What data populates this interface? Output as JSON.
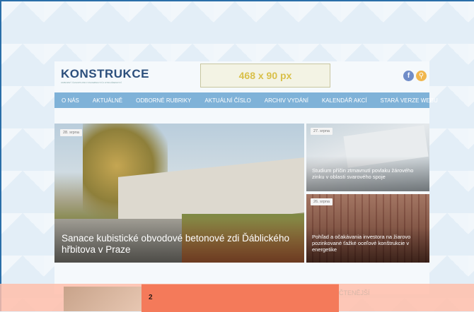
{
  "header": {
    "logo": "KONSTRUKCE",
    "logo_sub": "ODBORNÝ ČASOPIS PRO STAVEBNICTVÍ A STROJÍRENSTVÍ",
    "banner": "468 x 90 px",
    "facebook": "f",
    "search": "⚲"
  },
  "nav": [
    "O NÁS",
    "AKTUÁLNĚ",
    "ODBORNÉ RUBRIKY",
    "AKTUÁLNÍ ČÍSLO",
    "ARCHIV VYDÁNÍ",
    "KALENDÁŘ AKCÍ",
    "STARÁ VERZE WEBU"
  ],
  "hero": {
    "date": "28. srpna",
    "title": "Sanace kubistické obvodové betonové zdi Ďáblického hřbitova v Praze"
  },
  "cards": [
    {
      "date": "27. srpna",
      "title": "Studium příčin ztmavnutí povlaku žárového zinku v oblasti svarového spoje"
    },
    {
      "date": "26. srpna",
      "title": "Pohľad a očakávania investora na žiarovo pozinkované ťažké oceľové konštrukcie v energetike"
    }
  ],
  "overlay": {
    "mostread": "ČTENĚJŠÍ",
    "popup_number": "2"
  }
}
